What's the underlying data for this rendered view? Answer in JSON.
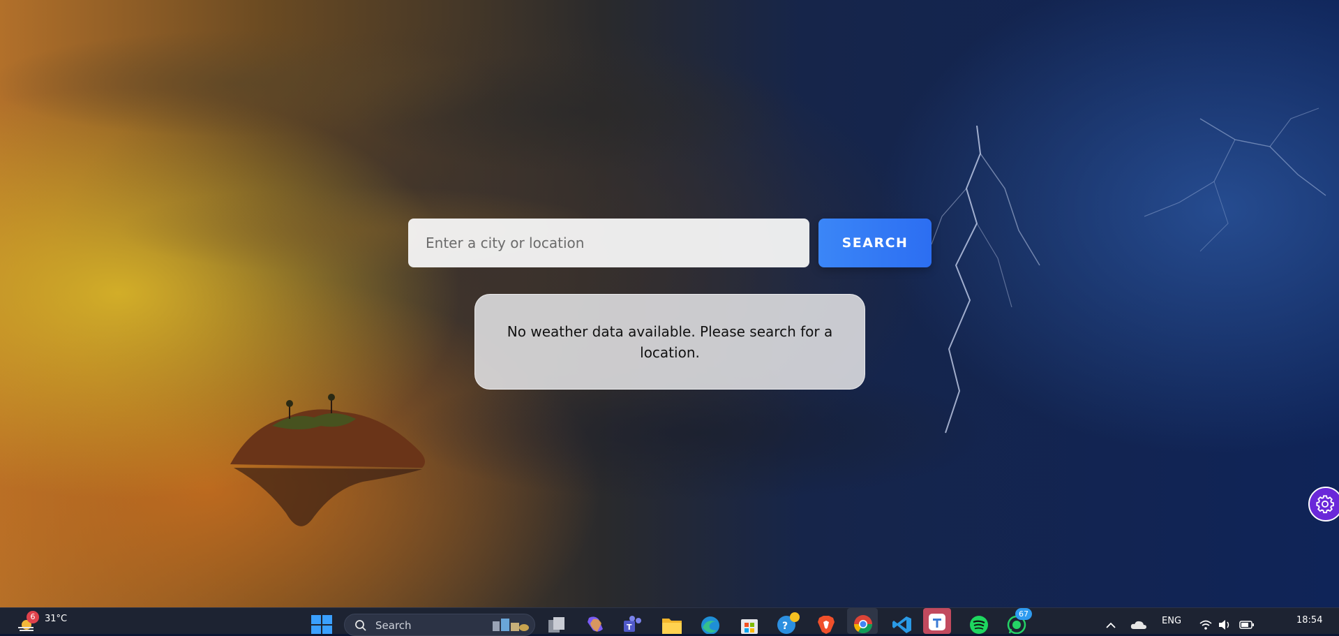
{
  "search": {
    "placeholder": "Enter a city or location",
    "button_label": "SEARCH"
  },
  "message": {
    "text": "No weather data available. Please search for a location."
  },
  "settings_button": {
    "icon": "gear-icon"
  },
  "taskbar": {
    "weather": {
      "temp": "31°C",
      "badge": "6"
    },
    "search_label": "Search",
    "apps": [
      "windows-start",
      "task-view",
      "copilot",
      "teams",
      "file-explorer",
      "edge",
      "microsoft-store",
      "quick-assist",
      "brave",
      "chrome",
      "vscode",
      "todo",
      "spotify",
      "whatsapp"
    ],
    "whatsapp_badge": "67",
    "language": "ENG",
    "time": "18:54"
  },
  "colors": {
    "accent": "#2c6ef2",
    "settings_fab": "#6a28d9",
    "taskbar": "#1d2332"
  }
}
